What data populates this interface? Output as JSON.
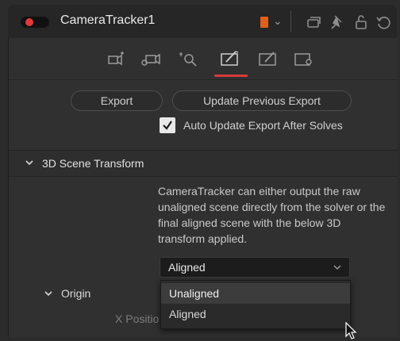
{
  "header": {
    "title": "CameraTracker1",
    "swatch_color": "#e0601a",
    "enabled_color": "#e13a3a",
    "icons": [
      "chevron-down-icon",
      "window-icon",
      "pin-icon",
      "lock-icon",
      "reset-icon"
    ]
  },
  "tabs": {
    "items": [
      "track-tab-icon",
      "camera-tab-icon",
      "solve-tab-icon",
      "export-tab-icon",
      "options-tab-icon",
      "settings-tab-icon"
    ],
    "active_index": 3,
    "active_color": "#d63a3a"
  },
  "export": {
    "export_label": "Export",
    "update_label": "Update Previous Export",
    "auto_update_label": "Auto Update Export After Solves",
    "auto_update_checked": true
  },
  "scene_transform": {
    "title": "3D Scene Transform",
    "description": "CameraTracker can either output the raw unaligned scene directly from the solver or the final aligned scene with the below 3D transform applied.",
    "selected": "Aligned",
    "options": [
      "Unaligned",
      "Aligned"
    ],
    "highlighted_option": "Unaligned"
  },
  "origin": {
    "label": "Origin",
    "x_position_label": "X Positio"
  }
}
